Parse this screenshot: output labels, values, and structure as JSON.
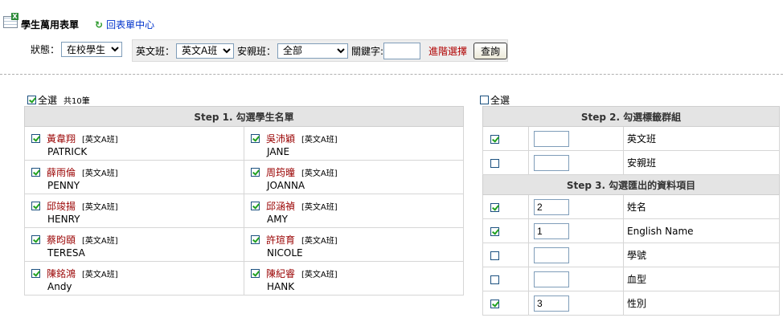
{
  "header": {
    "title": "學生萬用表單",
    "back_label": "回表單中心"
  },
  "filter": {
    "status_label": "狀態：",
    "status_value": "在校學生",
    "english_class_label": "英文班：",
    "english_class_value": "英文A班",
    "parent_class_label": "安親班：",
    "parent_class_value": "全部",
    "keyword_label": "關鍵字:",
    "keyword_value": "",
    "advanced_label": "進階選擇",
    "query_label": "查詢"
  },
  "students": {
    "select_all_label": "全選",
    "count_label": "共10筆",
    "step_title": "Step 1. 勾選學生名單",
    "items": [
      {
        "name": "黃韋翔",
        "cls": "[英文A班]",
        "en": "PATRICK",
        "checked": true
      },
      {
        "name": "吳沛穎",
        "cls": "[英文A班]",
        "en": "JANE",
        "checked": true
      },
      {
        "name": "薛雨倫",
        "cls": "[英文A班]",
        "en": "PENNY",
        "checked": true
      },
      {
        "name": "周筠曈",
        "cls": "[英文A班]",
        "en": "JOANNA",
        "checked": true
      },
      {
        "name": "邱竣揚",
        "cls": "[英文A班]",
        "en": "HENRY",
        "checked": true
      },
      {
        "name": "邱涵禎",
        "cls": "[英文A班]",
        "en": "AMY",
        "checked": true
      },
      {
        "name": "蔡昀頤",
        "cls": "[英文A班]",
        "en": "TERESA",
        "checked": true
      },
      {
        "name": "許瑄育",
        "cls": "[英文A班]",
        "en": "NICOLE",
        "checked": true
      },
      {
        "name": "陳銘鴻",
        "cls": "[英文A班]",
        "en": "Andy",
        "checked": true
      },
      {
        "name": "陳紀睿",
        "cls": "[英文A班]",
        "en": "HANK",
        "checked": true
      }
    ]
  },
  "options": {
    "select_all_label": "全選",
    "step2_title": "Step 2. 勾選標籤群組",
    "step2_items": [
      {
        "label": "英文班",
        "order": "",
        "checked": true
      },
      {
        "label": "安親班",
        "order": "",
        "checked": false
      }
    ],
    "step3_title": "Step 3. 勾選匯出的資料項目",
    "step3_items": [
      {
        "label": "姓名",
        "order": "2",
        "checked": true
      },
      {
        "label": "English Name",
        "order": "1",
        "checked": true
      },
      {
        "label": "學號",
        "order": "",
        "checked": false
      },
      {
        "label": "血型",
        "order": "",
        "checked": false
      },
      {
        "label": "性別",
        "order": "3",
        "checked": true
      }
    ]
  }
}
